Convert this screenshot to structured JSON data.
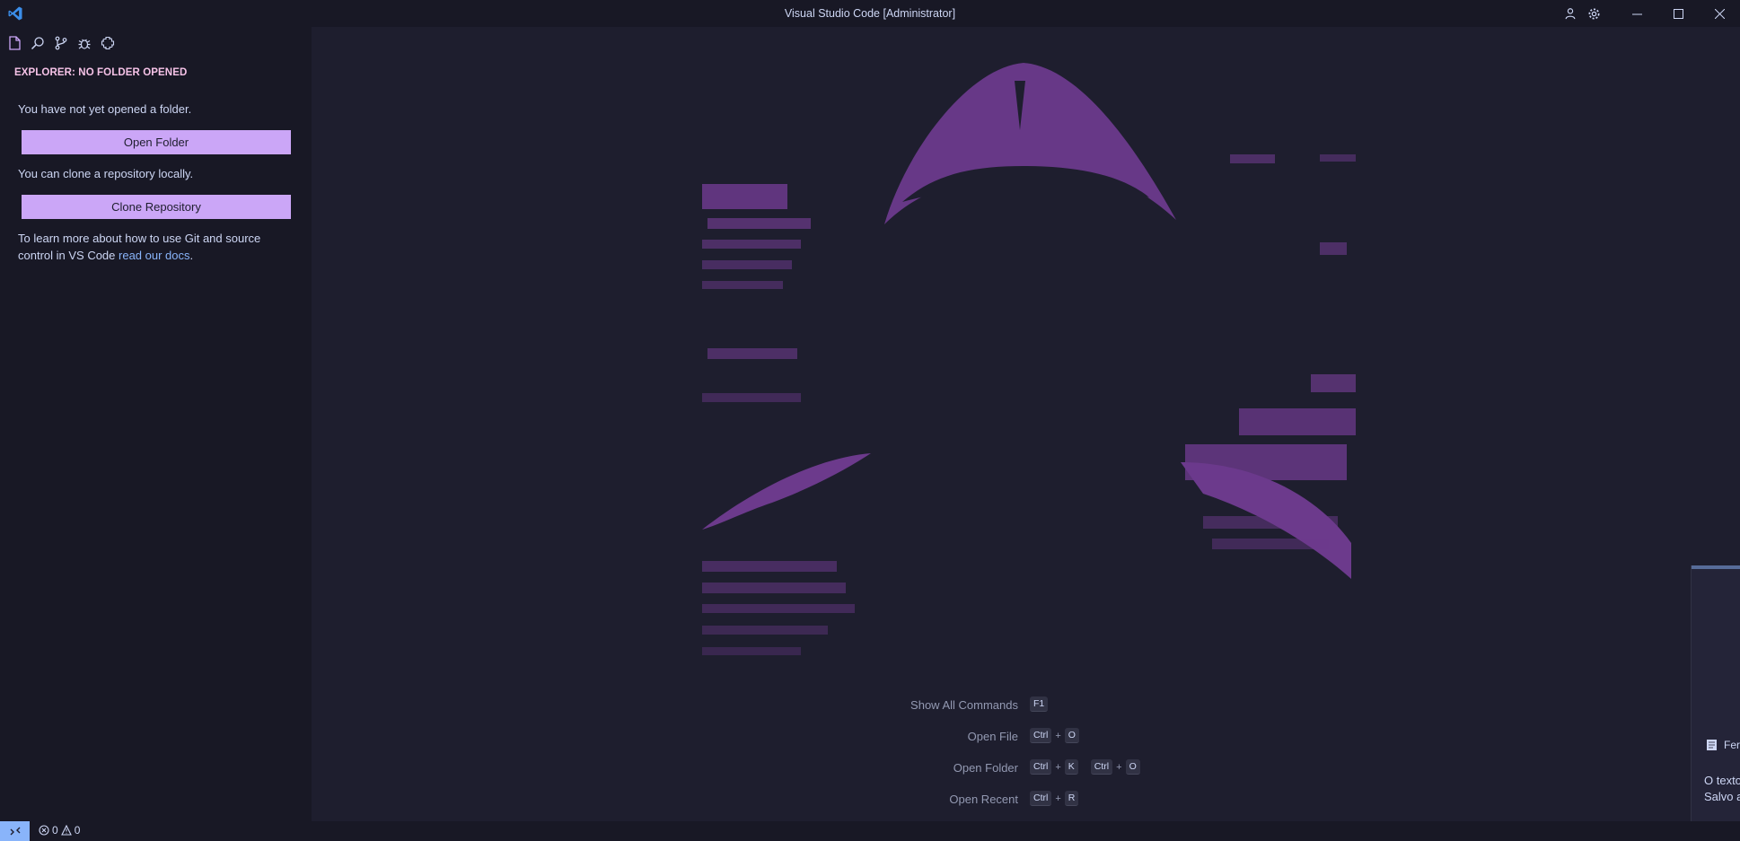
{
  "window": {
    "title": "Visual Studio Code [Administrator]"
  },
  "titlebar_icons": [
    "account-icon",
    "gear-icon"
  ],
  "sidebar": {
    "title": "EXPLORER: NO FOLDER OPENED",
    "no_folder_text": "You have not yet opened a folder.",
    "open_folder_label": "Open Folder",
    "clone_text": "You can clone a repository locally.",
    "clone_label": "Clone Repository",
    "learn_prefix": "To learn more about how to use Git and source control in VS Code ",
    "learn_link": "read our docs",
    "learn_suffix": "."
  },
  "shortcuts": [
    {
      "label": "Show All Commands",
      "keys": [
        [
          "F1"
        ]
      ]
    },
    {
      "label": "Open File",
      "keys": [
        [
          "Ctrl",
          "O"
        ]
      ]
    },
    {
      "label": "Open Folder",
      "keys": [
        [
          "Ctrl",
          "K"
        ],
        [
          "Ctrl",
          "O"
        ]
      ]
    },
    {
      "label": "Open Recent",
      "keys": [
        [
          "Ctrl",
          "R"
        ]
      ]
    }
  ],
  "statusbar": {
    "errors": "0",
    "warnings": "0"
  },
  "notification": {
    "title": "Fer",
    "line1": "O texto",
    "line2": "Salvo a"
  },
  "colors": {
    "accent": "#cba6f7",
    "link": "#89b4fa",
    "watermark": "#6c3a8c",
    "bg": "#1e1e2e",
    "sidebar_bg": "#181825"
  }
}
